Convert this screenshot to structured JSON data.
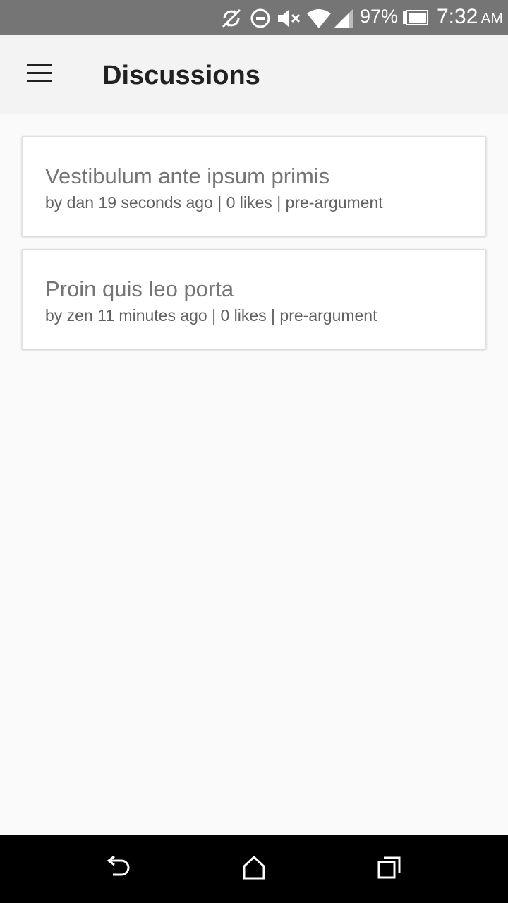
{
  "status_bar": {
    "icons": [
      "sync-disabled-icon",
      "do-not-disturb-icon",
      "volume-muted-icon",
      "wifi-icon",
      "cell-signal-icon",
      "battery-icon"
    ],
    "battery_percent": "97%",
    "time": "7:32",
    "ampm": "AM"
  },
  "app_bar": {
    "menu_icon": "hamburger-menu-icon",
    "title": "Discussions"
  },
  "discussions": [
    {
      "title": "Vestibulum ante ipsum primis",
      "meta": "by dan 19 seconds ago | 0 likes | pre-argument"
    },
    {
      "title": "Proin quis leo porta",
      "meta": "by zen 11 minutes ago | 0 likes | pre-argument"
    }
  ],
  "nav_bar": {
    "back_icon": "back-icon",
    "home_icon": "home-icon",
    "recents_icon": "recents-icon"
  }
}
